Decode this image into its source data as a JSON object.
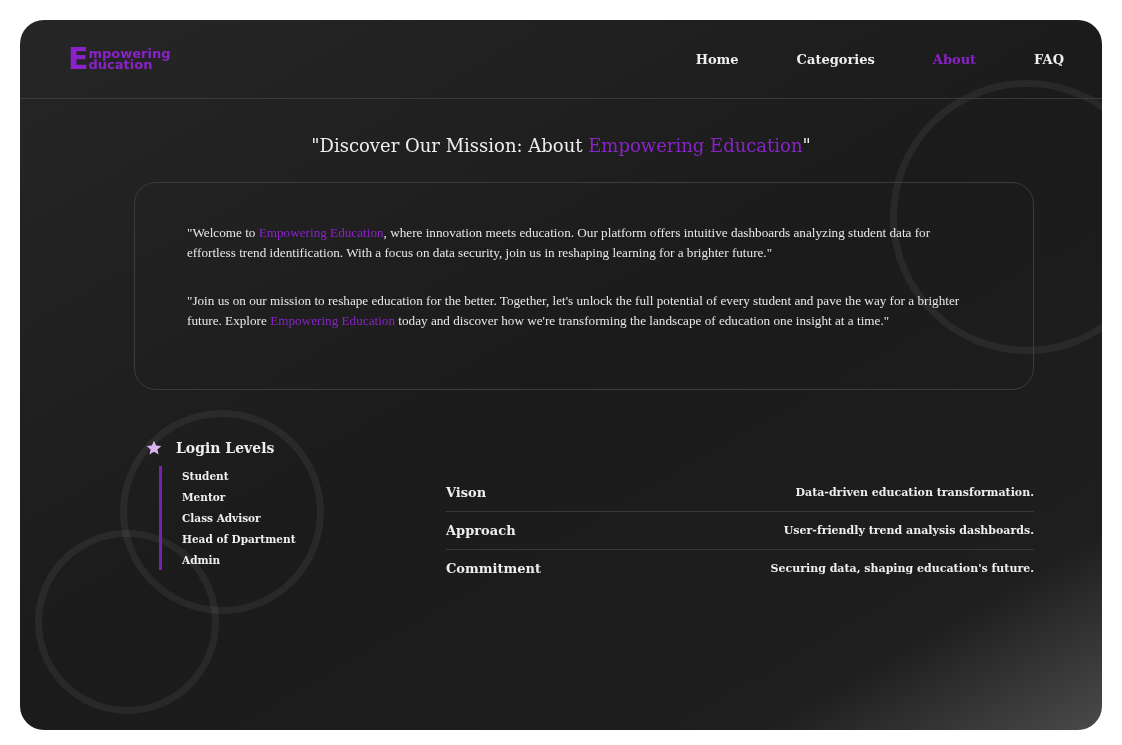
{
  "logo": {
    "initial": "E",
    "line1": "mpowering",
    "line2": "ducation"
  },
  "nav": [
    {
      "label": "Home",
      "selected": false
    },
    {
      "label": "Categories",
      "selected": false
    },
    {
      "label": "About",
      "selected": true
    },
    {
      "label": "FAQ",
      "selected": false
    }
  ],
  "heading": [
    {
      "text": "\"Discover Our Mission: About ",
      "highlight": false
    },
    {
      "text": "Empowering Education",
      "highlight": true
    },
    {
      "text": "\"",
      "highlight": false
    }
  ],
  "paragraphs": [
    [
      {
        "text": "\"Welcome to ",
        "highlight": false
      },
      {
        "text": "Empowering Education",
        "highlight": true
      },
      {
        "text": ", where innovation meets education. Our platform offers intuitive dashboards analyzing student data for effortless trend identification. With a focus on data security, join us in reshaping learning for a brighter future.\"",
        "highlight": false
      }
    ],
    [
      {
        "text": "\"Join us on our mission to reshape education for the better. Together, let's unlock the full potential of every student and pave the way for a brighter future. Explore ",
        "highlight": false
      },
      {
        "text": "Empowering Education",
        "highlight": true
      },
      {
        "text": " today and discover how we're transforming the landscape of education one insight at a time.\"",
        "highlight": false
      }
    ]
  ],
  "login_levels": {
    "title": "Login Levels",
    "items": [
      "Student",
      "Mentor",
      "Class Advisor",
      "Head of Dpartment",
      "Admin"
    ]
  },
  "values": [
    {
      "label": "Vison",
      "text": "Data-driven education transformation."
    },
    {
      "label": "Approach",
      "text": "User-friendly trend analysis dashboards."
    },
    {
      "label": "Commitment",
      "text": "Securing data, shaping education's future."
    }
  ]
}
